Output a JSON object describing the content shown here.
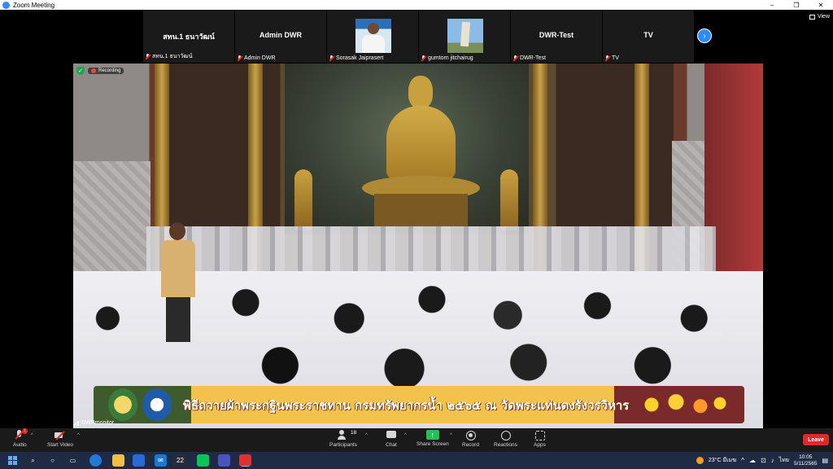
{
  "window": {
    "title": "Zoom Meeting",
    "controls": [
      "–",
      "❐",
      "✕"
    ]
  },
  "gallery": {
    "tiles": [
      {
        "display_name": "สทน.1 ธนาวัฒน์",
        "label": "สทน.1 ธนาวัฒน์",
        "video": false
      },
      {
        "display_name": "Admin DWR",
        "label": "Admin DWR",
        "video": false
      },
      {
        "display_name": "",
        "label": "Sorasak Jaiprasert",
        "video": true,
        "thumb": "person"
      },
      {
        "display_name": "",
        "label": "gumtorn jitchairug",
        "video": true,
        "thumb": "tower"
      },
      {
        "display_name": "DWR-Test",
        "label": "DWR-Test",
        "video": false
      },
      {
        "display_name": "TV",
        "label": "TV",
        "video": false
      }
    ],
    "view_label": "View"
  },
  "main_video": {
    "recording_label": "Recording",
    "banner_text": "พิธีถวายผ้าพระกฐินพระราชทาน กรมทรัพยากรน้ำ ๒๕๖๕  ณ วัดพระแท่นดงรังวรวิหาร",
    "speaker_label": "DWRmonitor"
  },
  "toolbar": {
    "audio": "Audio",
    "start_video": "Start Video",
    "participants": "Participants",
    "participants_count": "18",
    "chat": "Chat",
    "share_screen": "Share Screen",
    "record": "Record",
    "reactions": "Reactions",
    "apps": "Apps",
    "leave": "Leave",
    "audio_badge": "!"
  },
  "taskbar": {
    "apps": [
      "search-icon",
      "cortana-icon",
      "task-view-icon",
      "edge-icon",
      "file-explorer-icon",
      "store-icon",
      "mail-icon",
      "22",
      "line-icon",
      "teams-icon",
      "zoom-icon",
      "screen-recorder-icon"
    ],
    "badge_22": "22",
    "weather": "23°C  มีเมฆ",
    "language": "ไทย",
    "time": "10:05",
    "date": "5/11/2565"
  },
  "colors": {
    "zoom_blue": "#2d8cff",
    "share_green": "#23c05a",
    "leave_red": "#e02828",
    "toolbar_bg": "#1a1a1a",
    "taskbar_bg": "#1f2a44"
  }
}
